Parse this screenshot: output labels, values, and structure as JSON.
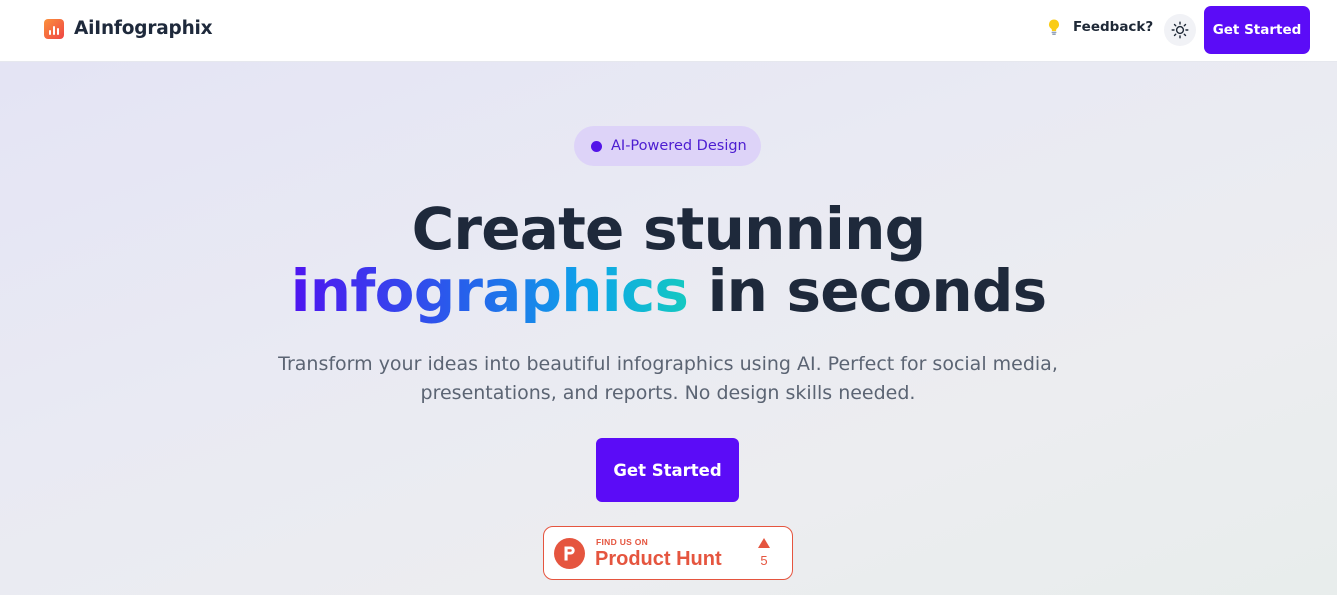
{
  "header": {
    "brand_name": "AiInfographix",
    "logo_icon": "bar-chart-icon",
    "feedback_label": "Feedback?",
    "feedback_icon": "lightbulb-icon",
    "theme_toggle_icon": "sun-icon",
    "cta_label": "Get Started"
  },
  "hero": {
    "badge_label": "AI-Powered Design",
    "headline_line1": "Create stunning",
    "headline_highlight": "infographics",
    "headline_rest": "in seconds",
    "subtitle_line1": "Transform your ideas into beautiful infographics using AI. Perfect for social media,",
    "subtitle_line2": "presentations, and reports. No design skills needed.",
    "cta_label": "Get Started"
  },
  "product_hunt": {
    "kicker": "FIND US ON",
    "name": "Product Hunt",
    "upvote_count": "5",
    "logo_icon": "product-hunt-icon",
    "upvote_icon": "triangle-up-icon"
  },
  "colors": {
    "accent": "#5b0cf7",
    "heading": "#1e293b",
    "product_hunt": "#e5553f",
    "badge_bg": "#ddd3f8",
    "badge_text": "#4c1dd1",
    "gradient_start": "#4f14f0",
    "gradient_end": "#14c9c1"
  }
}
